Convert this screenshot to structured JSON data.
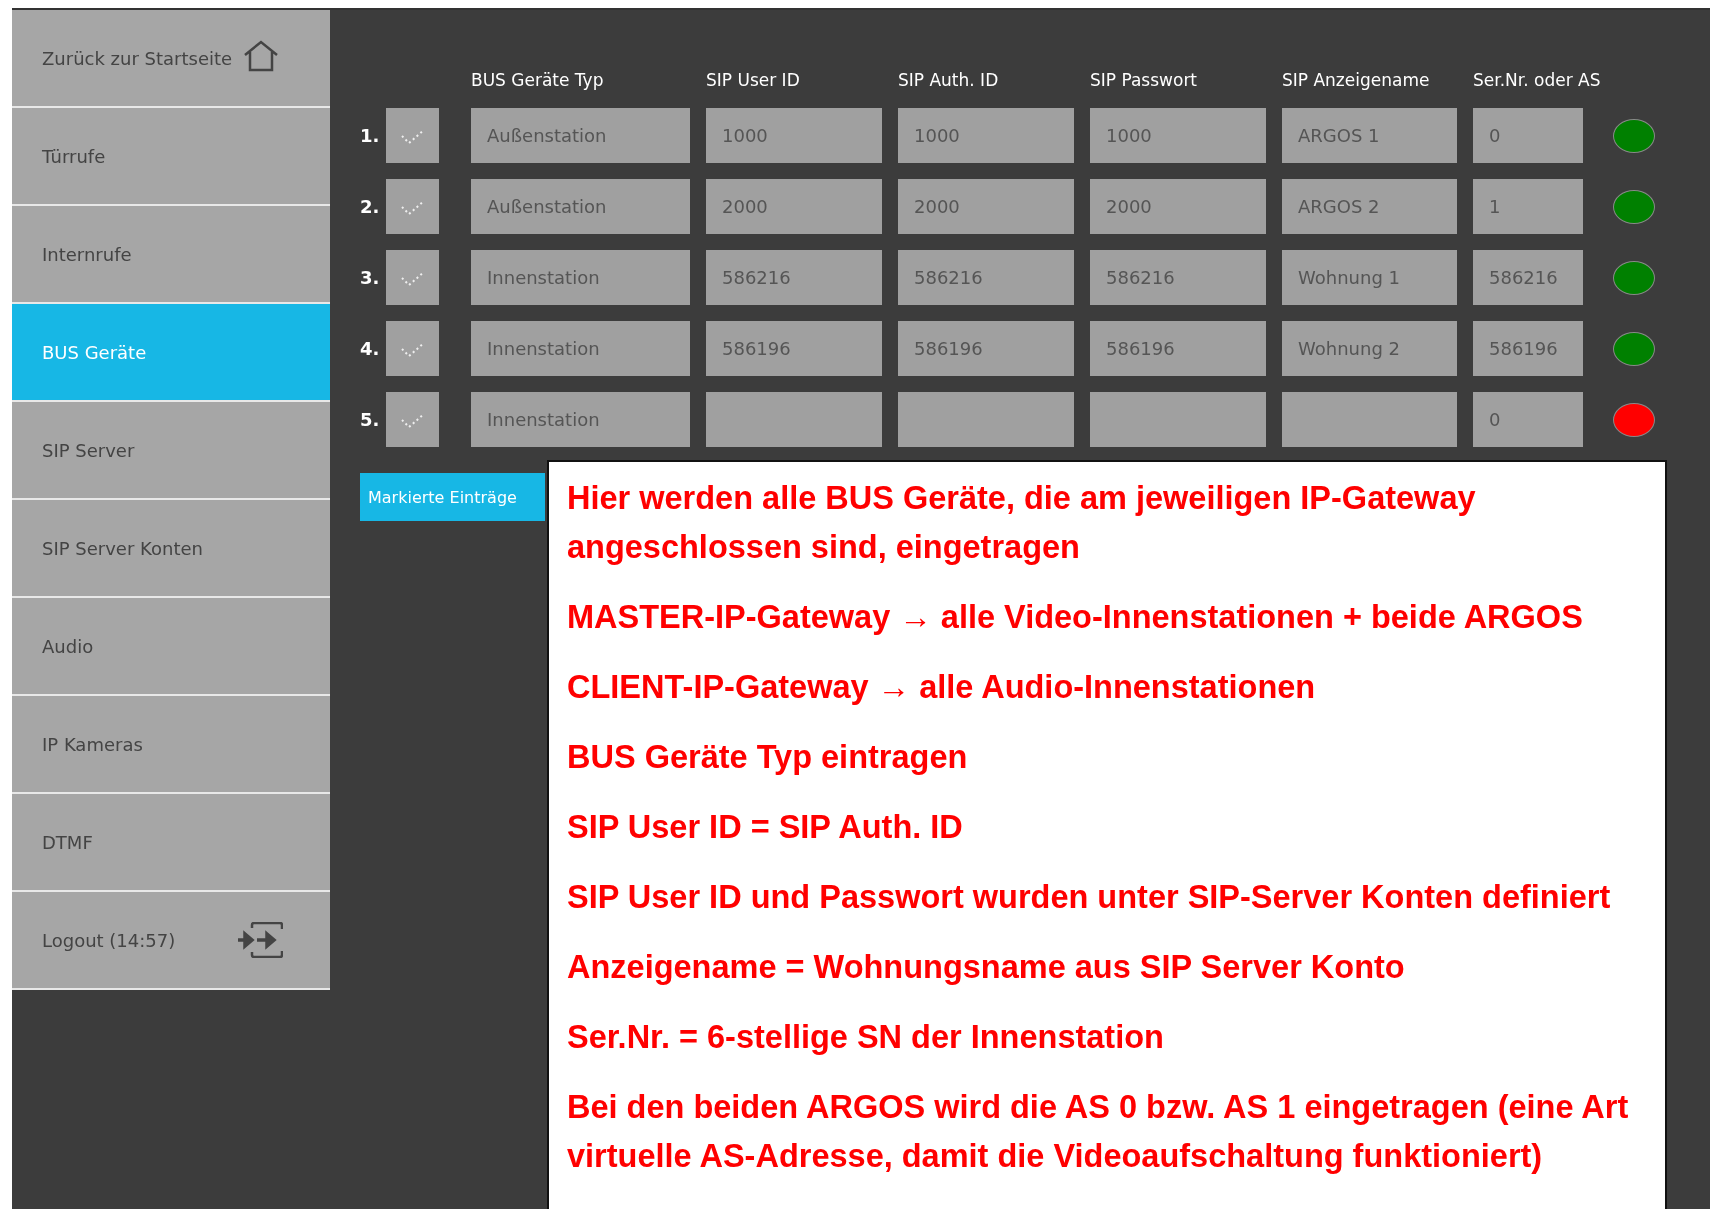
{
  "sidebar": {
    "items": [
      {
        "label": "Zurück zur Startseite",
        "kind": "home",
        "selected": false
      },
      {
        "label": "Türrufe",
        "kind": "link",
        "selected": false
      },
      {
        "label": "Internrufe",
        "kind": "link",
        "selected": false
      },
      {
        "label": "BUS Geräte",
        "kind": "link",
        "selected": true
      },
      {
        "label": "SIP Server",
        "kind": "link",
        "selected": false
      },
      {
        "label": "SIP Server Konten",
        "kind": "link",
        "selected": false
      },
      {
        "label": "Audio",
        "kind": "link",
        "selected": false
      },
      {
        "label": "IP Kameras",
        "kind": "link",
        "selected": false
      },
      {
        "label": "DTMF",
        "kind": "link",
        "selected": false
      },
      {
        "label": "Logout (14:57)",
        "kind": "logout",
        "selected": false
      }
    ]
  },
  "table": {
    "columns": [
      "BUS Geräte Typ",
      "SIP User ID",
      "SIP Auth. ID",
      "SIP Passwort",
      "SIP Anzeigename",
      "Ser.Nr. oder AS"
    ],
    "rows": [
      {
        "number": "1.",
        "checked": false,
        "cells": [
          "Außenstation",
          "1000",
          "1000",
          "1000",
          "ARGOS 1",
          "0"
        ],
        "color": "#008000"
      },
      {
        "number": "2.",
        "checked": false,
        "cells": [
          "Außenstation",
          "2000",
          "2000",
          "2000",
          "ARGOS 2",
          "1"
        ],
        "color": "#008000"
      },
      {
        "number": "3.",
        "checked": false,
        "cells": [
          "Innenstation",
          "586216",
          "586216",
          "586216",
          "Wohnung 1",
          "586216"
        ],
        "color": "#008000"
      },
      {
        "number": "4.",
        "checked": false,
        "cells": [
          "Innenstation",
          "586196",
          "586196",
          "586196",
          "Wohnung 2",
          "586196"
        ],
        "color": "#008000"
      },
      {
        "number": "5.",
        "checked": false,
        "cells": [
          "Innenstation",
          null,
          null,
          null,
          null,
          "0"
        ],
        "color": "#ff0000"
      }
    ]
  },
  "delete_button": {
    "label": "Markierte Einträge"
  },
  "note": {
    "paragraphs": [
      "Hier werden alle BUS Geräte, die am jeweiligen IP-Gateway angeschlossen sind, eingetragen",
      "MASTER-IP-Gateway → alle Video-Innenstationen + beide ARGOS",
      "CLIENT-IP-Gateway → alle Audio-Innenstationen",
      "BUS Geräte Typ eintragen",
      "SIP User ID = SIP Auth. ID",
      "SIP User ID und Passwort wurden unter SIP-Server Konten definiert",
      "Anzeigename = Wohnungsname aus SIP Server Konto",
      "Ser.Nr. = 6-stellige SN der Innenstation",
      "Bei den beiden ARGOS wird die AS 0 bzw. AS 1 eingetragen (eine Art virtuelle AS-Adresse, damit die Videoaufschaltung funktioniert)"
    ]
  }
}
